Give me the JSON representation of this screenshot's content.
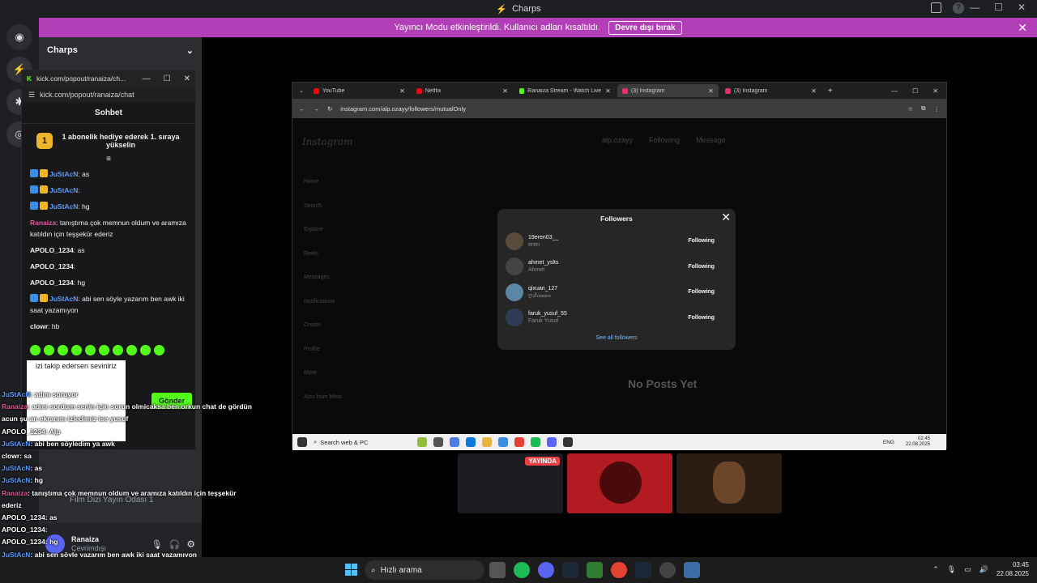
{
  "discord": {
    "window_title": "Charps",
    "banner_text": "Yayıncı Modu etkinleştirildi. Kullanıcı adları kısaltıldı.",
    "banner_button": "Devre dışı bırak",
    "server_name": "Charps",
    "voice_channel": "Film Dizi Yayın Odası 1",
    "voice_status": "Bağlantı Kuruldu",
    "voice_sub": "Charps",
    "user_name": "Ranaiza",
    "user_status": "Çevrimdışı"
  },
  "kick": {
    "window_title": "kick.com/popout/ranaiza/ch...",
    "url": "kick.com/popout/ranaiza/chat",
    "header": "Sohbet",
    "promo_rank": "1",
    "promo_text": "1 abonelik hediye ederek 1. sıraya yükselin",
    "messages": [
      {
        "user": "JuStAcN",
        "text": ": as",
        "color": "blue"
      },
      {
        "user": "JuStAcN",
        "text": ":",
        "color": "blue"
      },
      {
        "user": "JuStAcN",
        "text": ": hg",
        "color": "blue"
      },
      {
        "user": "Ranaiza",
        "text": ": tanıştıma çok memnun oldum ve aramıza katıldın için teşşekür ederiz",
        "color": "pink"
      },
      {
        "user": "APOLO_1234",
        "text": ": as",
        "color": "white"
      },
      {
        "user": "APOLO_1234",
        "text": ":",
        "color": "white"
      },
      {
        "user": "APOLO_1234",
        "text": ": hg",
        "color": "white"
      },
      {
        "user": "JuStAcN",
        "text": ": abi sen söyle yazarım ben awk iki saat yazamıyon",
        "color": "blue"
      },
      {
        "user": "clowr",
        "text": ": hb",
        "color": "white"
      }
    ],
    "tooltip_text": "izi takip edersen seviniriz",
    "send_label": "Gönder"
  },
  "overlay_chat": [
    {
      "user": "JuStAcN",
      "text": ": adını soruyor",
      "color": "blue"
    },
    {
      "user": "Ranaiza",
      "text": ": adını sordum senin için sorun olmicaksa ben orkun chat de gördün",
      "color": "pink"
    },
    {
      "user": "",
      "text": "acun şu an ekranını izledimiz ise yusuf",
      "color": "white"
    },
    {
      "user": "APOLO_1234",
      "text": ": Alp",
      "color": "white"
    },
    {
      "user": "JuStAcN",
      "text": ": abi ben söyledim ya awk",
      "color": "blue"
    },
    {
      "user": "clowr",
      "text": ": sa",
      "color": "white"
    },
    {
      "user": "JuStAcN",
      "text": ": as",
      "color": "blue"
    },
    {
      "user": "JuStAcN",
      "text": ": hg",
      "color": "blue"
    },
    {
      "user": "Ranaiza",
      "text": ": tanıştıma çok memnun oldum ve aramıza katıldın için teşşekür",
      "color": "pink"
    },
    {
      "user": "",
      "text": "ederiz",
      "color": "white"
    },
    {
      "user": "APOLO_1234",
      "text": ": as",
      "color": "white"
    },
    {
      "user": "APOLO_1234",
      "text": ":",
      "color": "white"
    },
    {
      "user": "APOLO_1234",
      "text": ": hg",
      "color": "white"
    },
    {
      "user": "JuStAcN",
      "text": ": abi sen söyle yazarım ben awk iki saat yazamıyon",
      "color": "blue"
    },
    {
      "user": "clowr",
      "text": ": hb",
      "color": "white"
    }
  ],
  "browser": {
    "tabs": [
      {
        "label": "YouTube",
        "color": "#ff0000"
      },
      {
        "label": "Netflix",
        "color": "#e50914"
      },
      {
        "label": "Ranaiza Stream - Watch Live on",
        "color": "#53fc18"
      },
      {
        "label": "(3) Instagram",
        "color": "#e1306c"
      },
      {
        "label": "(3) Instagram",
        "color": "#e1306c"
      }
    ],
    "url": "instagram.com/alp.ozayy/followers/mutualOnly",
    "ig_logo": "Instagram",
    "ig_nav": [
      "Home",
      "Search",
      "Explore",
      "Reels",
      "Messages",
      "Notifications",
      "Create",
      "Profile",
      "More",
      "Also from Meta"
    ],
    "profile_name": "alp.ozayy",
    "following_btn": "Following",
    "message_btn": "Message",
    "no_posts": "No Posts Yet",
    "modal": {
      "title": "Followers",
      "rows": [
        {
          "username": "19eren03__",
          "name": "eren",
          "action": "Following"
        },
        {
          "username": "ahmet_yslts",
          "name": "Ahmet",
          "action": "Following"
        },
        {
          "username": "qixuan_127",
          "name": "ღ𝒬𝒾𝓍𝓊𝒶𝓃",
          "action": "Following"
        },
        {
          "username": "faruk_yusuf_55",
          "name": "Faruk Yusuf",
          "action": "Following"
        }
      ],
      "see_all": "See all followers"
    },
    "inner_search": "Search web & PC",
    "inner_lang": "ENG",
    "inner_time": "02:45",
    "inner_date": "22.08.2025"
  },
  "thumbs": {
    "live_label": "YAYINDA"
  },
  "taskbar": {
    "search": "Hızlı arama",
    "time": "03:45",
    "date": "22.08.2025"
  }
}
